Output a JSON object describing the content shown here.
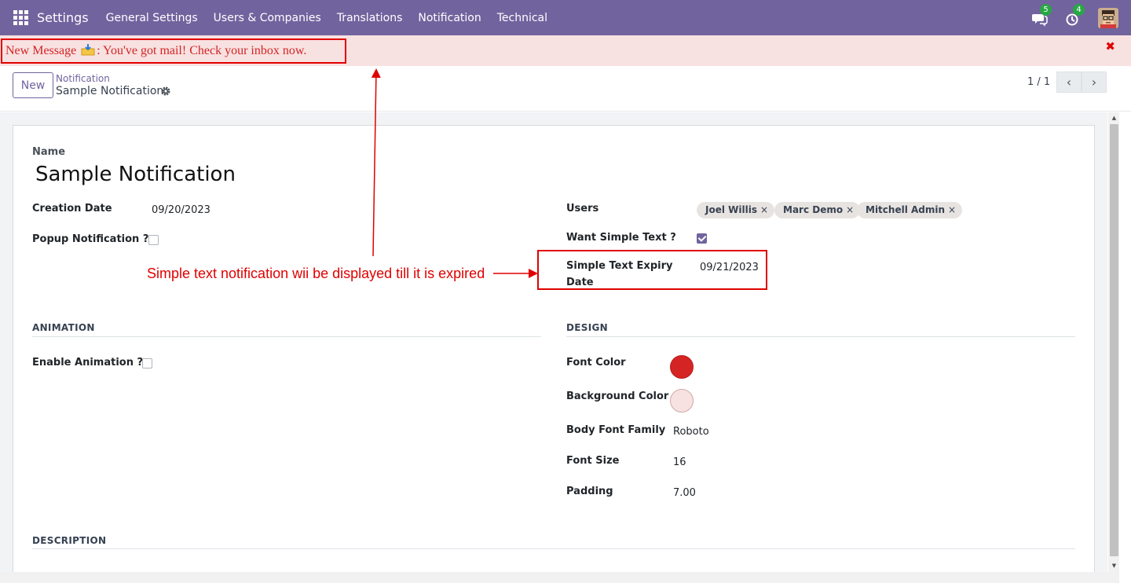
{
  "navbar": {
    "app_name": "Settings",
    "menu": [
      "General Settings",
      "Users & Companies",
      "Translations",
      "Notification",
      "Technical"
    ],
    "messages_count": "5",
    "activities_count": "4"
  },
  "banner": {
    "prefix": "New Message ",
    "text": ": You've got mail! Check your inbox now.",
    "close": "✖",
    "text_color": "#d42424",
    "background": "#f8e1e1"
  },
  "control": {
    "new_label": "New",
    "breadcrumb_parent": "Notification",
    "breadcrumb_current": "Sample Notification",
    "pager": "1 / 1",
    "prev": "‹",
    "next": "›"
  },
  "form": {
    "name_label": "Name",
    "name_value": "Sample Notification",
    "creation_date_label": "Creation Date",
    "creation_date_value": "09/20/2023",
    "popup_label": "Popup Notification ?",
    "popup_checked": false,
    "users_label": "Users",
    "users": [
      "Joel Willis",
      "Marc Demo",
      "Mitchell Admin"
    ],
    "want_simple_label": "Want Simple Text ?",
    "want_simple_checked": true,
    "expiry_label_line1": "Simple Text Expiry",
    "expiry_label_line2": "Date",
    "expiry_value": "09/21/2023",
    "animation_section": "ANIMATION",
    "enable_animation_label": "Enable Animation ?",
    "enable_animation_checked": false,
    "design_section": "DESIGN",
    "font_color_label": "Font Color",
    "font_color": "#d42424",
    "bg_color_label": "Background Color",
    "bg_color": "#f8e1e1",
    "body_font_label": "Body Font Family",
    "body_font_value": "Roboto",
    "font_size_label": "Font Size",
    "font_size_value": "16",
    "padding_label": "Padding",
    "padding_value": "7.00",
    "description_section": "DESCRIPTION"
  },
  "annotation": {
    "text": "Simple text notification wii be displayed till it is expired",
    "color": "#e00000"
  }
}
